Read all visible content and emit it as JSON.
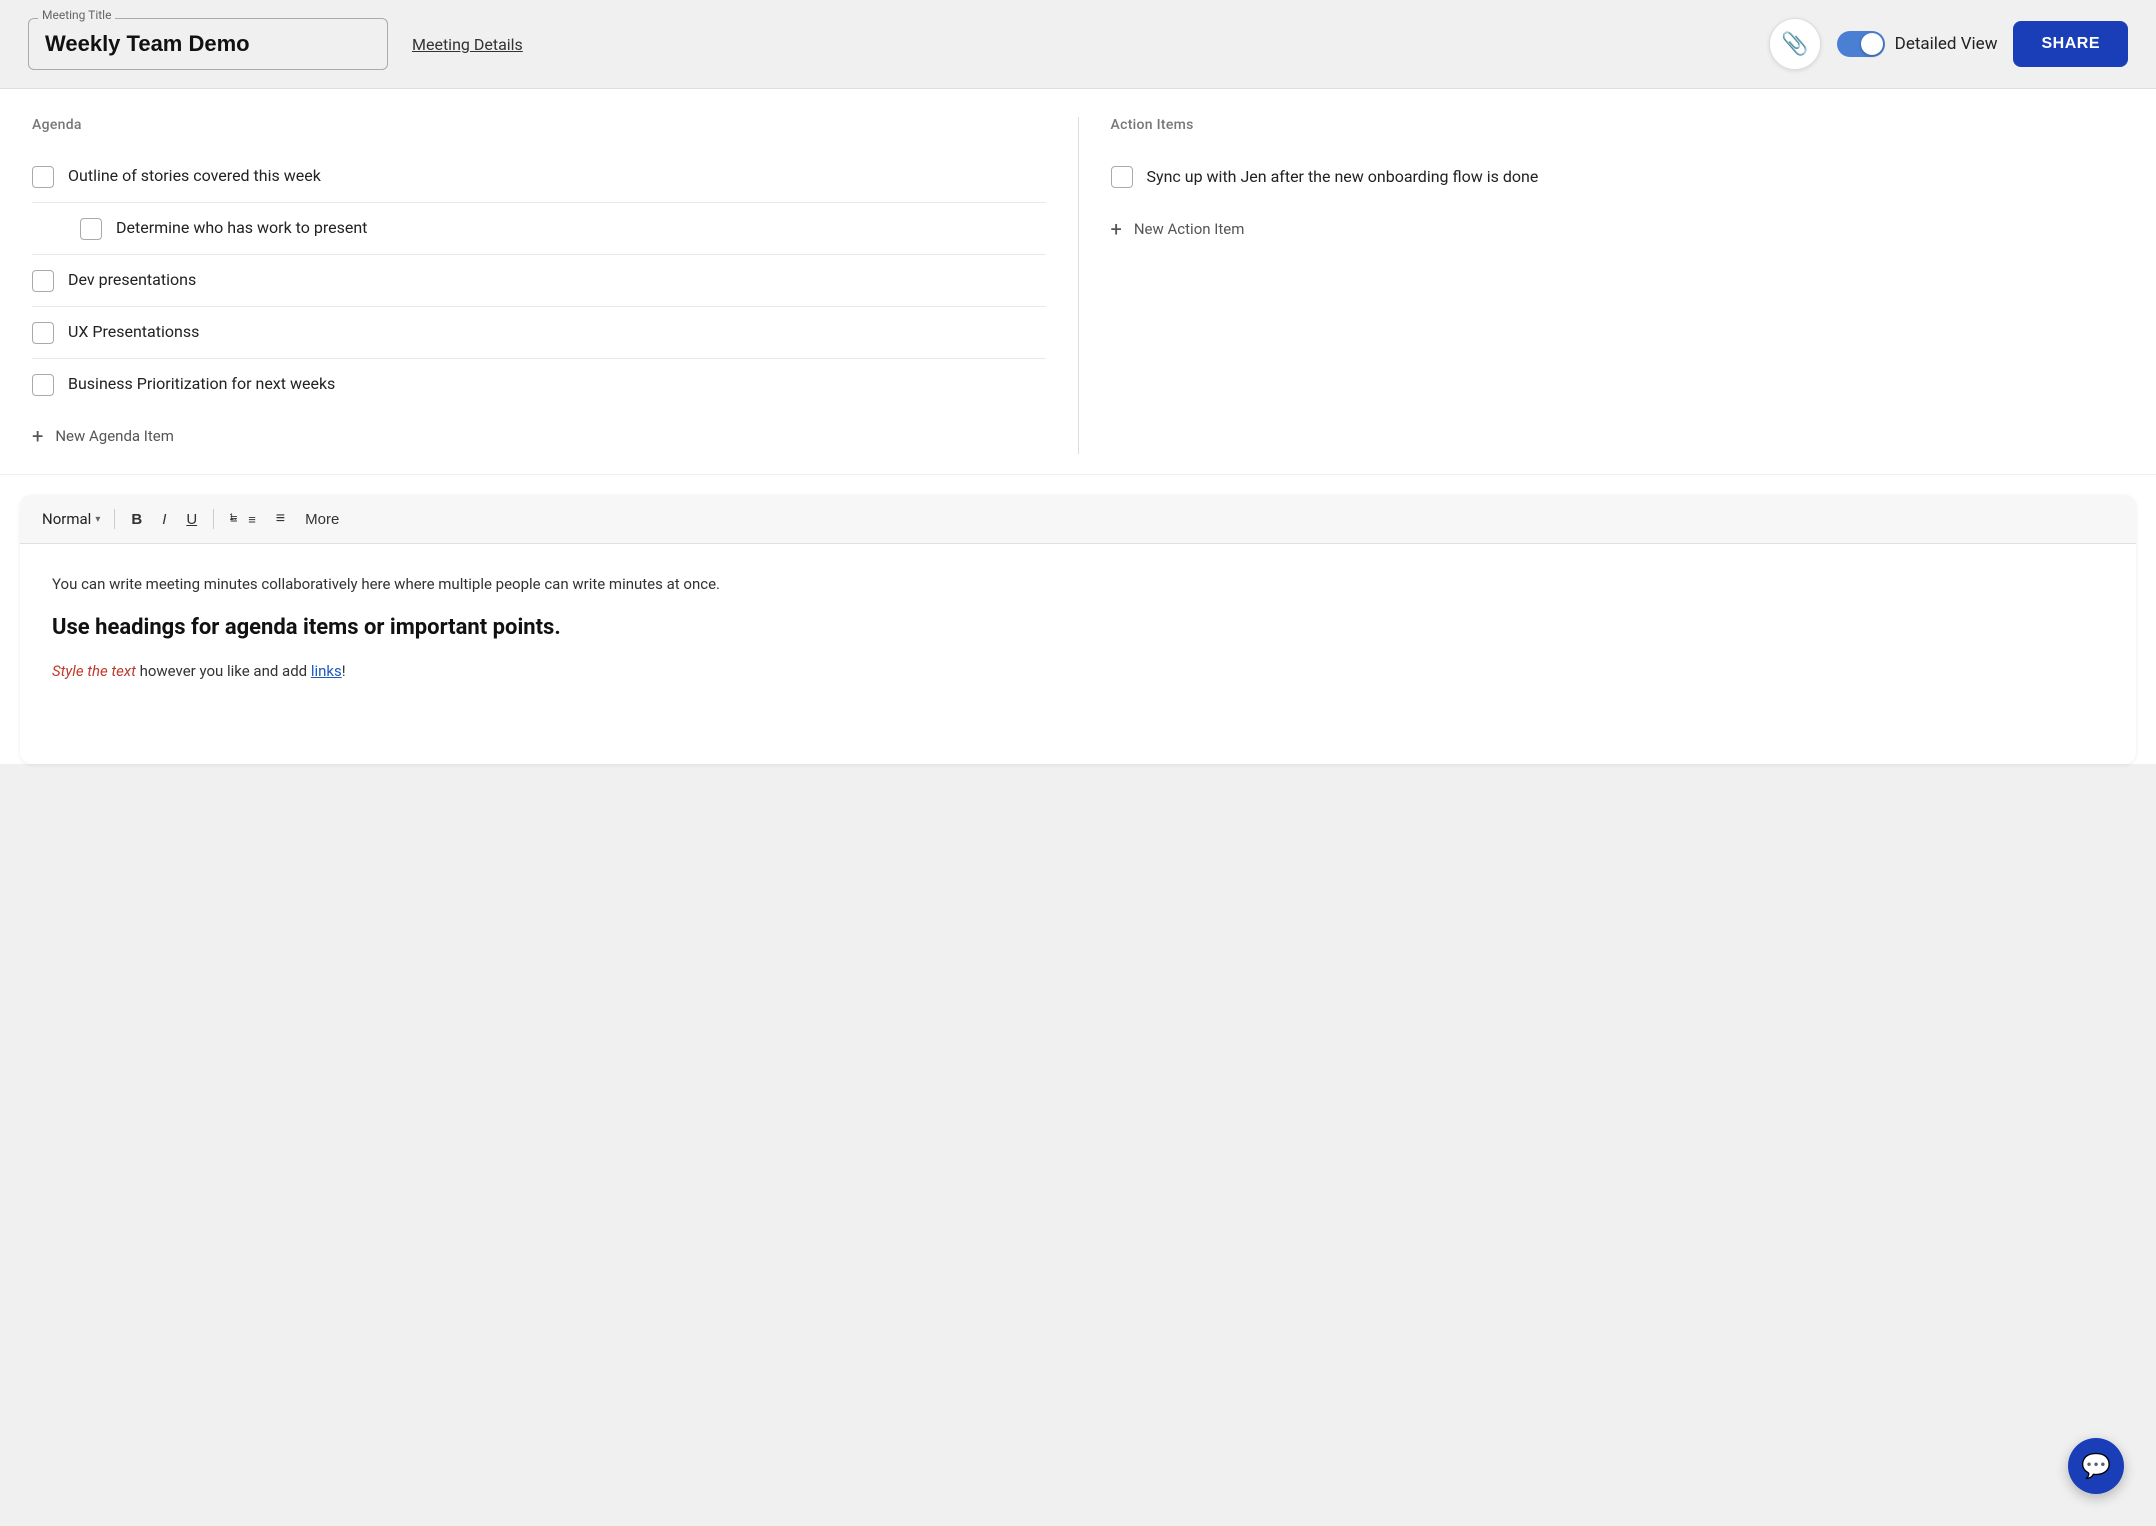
{
  "header": {
    "meeting_title_label": "Meeting Title",
    "meeting_title_value": "Weekly Team Demo",
    "meeting_details_link": "Meeting Details",
    "attach_icon": "📎",
    "toggle_label": "Detailed View",
    "toggle_checked": true,
    "share_button_label": "SHARE"
  },
  "agenda": {
    "title": "Agenda",
    "items": [
      {
        "id": 1,
        "text": "Outline of stories covered this week",
        "checked": false,
        "sub": false
      },
      {
        "id": 2,
        "text": "Determine who has work to present",
        "checked": false,
        "sub": true
      },
      {
        "id": 3,
        "text": "Dev presentations",
        "checked": false,
        "sub": false
      },
      {
        "id": 4,
        "text": "UX Presentationss",
        "checked": false,
        "sub": false
      },
      {
        "id": 5,
        "text": "Business Prioritization for next weeks",
        "checked": false,
        "sub": false
      }
    ],
    "add_item_label": "New Agenda Item"
  },
  "action_items": {
    "title": "Action Items",
    "items": [
      {
        "id": 1,
        "text": "Sync up with Jen after the new onboarding flow is done",
        "checked": false
      }
    ],
    "add_item_label": "New Action Item"
  },
  "editor": {
    "toolbar": {
      "style_select_label": "Normal",
      "style_select_chevron": "▾",
      "bold_label": "B",
      "italic_label": "I",
      "underline_label": "U",
      "ordered_list_icon": "≡",
      "unordered_list_icon": "≡",
      "more_label": "More"
    },
    "content": {
      "para1": "You can write meeting minutes collaboratively here where multiple people can write minutes at once.",
      "heading": "Use headings for agenda items or important points.",
      "styled_prefix_italic": "Style the text",
      "styled_middle": " however you like and add ",
      "styled_link": "links",
      "styled_suffix": "!"
    }
  },
  "chat_fab_icon": "💬"
}
